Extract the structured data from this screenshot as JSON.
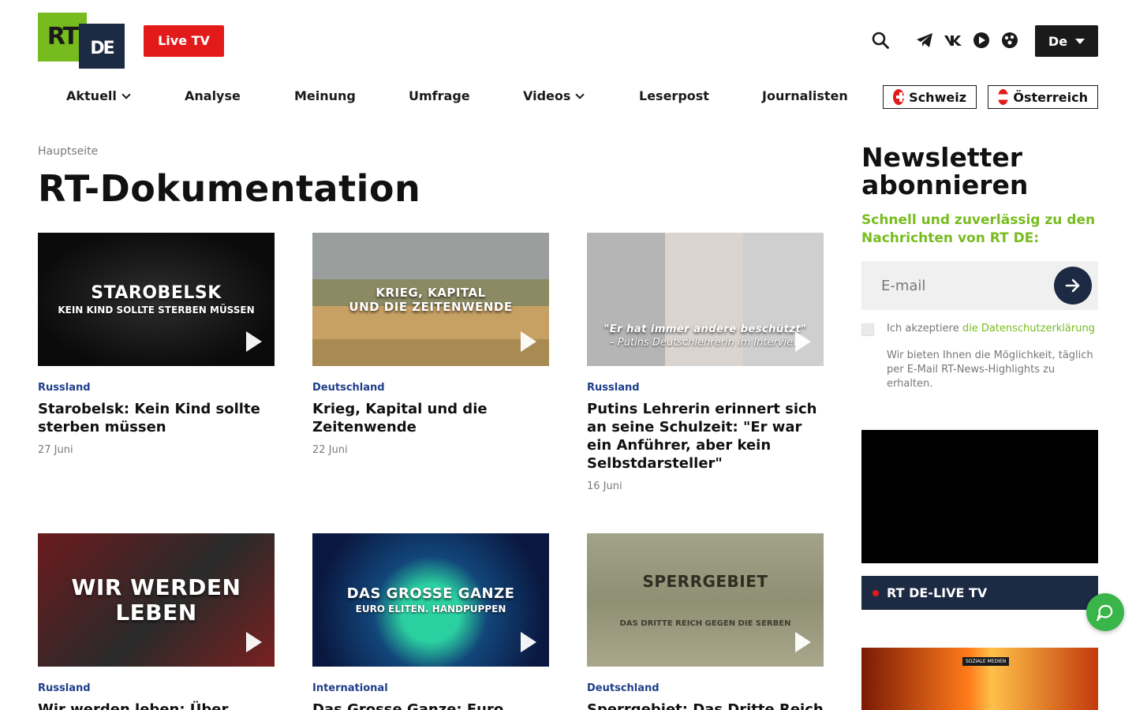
{
  "brand": {
    "logo_left": "RT",
    "logo_right": "DE",
    "green": "#77bc1f",
    "navy": "#1c2a44",
    "red": "#e31a1a"
  },
  "header": {
    "live_label": "Live TV",
    "lang_label": "De",
    "icons": [
      "search-icon",
      "telegram-icon",
      "vk-icon",
      "rutube-icon",
      "odysee-icon"
    ]
  },
  "nav": {
    "items": [
      {
        "label": "Aktuell",
        "has_dropdown": true
      },
      {
        "label": "Analyse",
        "has_dropdown": false
      },
      {
        "label": "Meinung",
        "has_dropdown": false
      },
      {
        "label": "Umfrage",
        "has_dropdown": false
      },
      {
        "label": "Videos",
        "has_dropdown": true
      },
      {
        "label": "Leserpost",
        "has_dropdown": false
      },
      {
        "label": "Journalisten",
        "has_dropdown": false
      }
    ],
    "countries": [
      {
        "label": "Schweiz"
      },
      {
        "label": "Österreich"
      }
    ]
  },
  "main": {
    "breadcrumb": "Hauptseite",
    "title": "RT-Dokumentation",
    "cards": [
      {
        "category": "Russland",
        "title": "Starobelsk: Kein Kind sollte sterben müssen",
        "date": "27 Juni",
        "thumb_line1": "STAROBELSK",
        "thumb_line2": "KEIN KIND SOLLTE STERBEN MÜSSEN"
      },
      {
        "category": "Deutschland",
        "title": "Krieg, Kapital und die Zeitenwende",
        "date": "22 Juni",
        "thumb_line1": "KRIEG, KAPITAL",
        "thumb_line2": "UND DIE ZEITENWENDE"
      },
      {
        "category": "Russland",
        "title": "Putins Lehrerin erinnert sich an seine Schulzeit: \"Er war ein Anführer, aber kein Selbstdarsteller\"",
        "date": "16 Juni",
        "thumb_line1": "\"Er hat immer andere beschützt\"",
        "thumb_line2": "– Putins Deutschlehrerin im Interview"
      },
      {
        "category": "Russland",
        "title": "Wir werden leben: Über",
        "date": "",
        "thumb_line1": "WIR WERDEN",
        "thumb_line2": "LEBEN"
      },
      {
        "category": "International",
        "title": "Das Grosse Ganze: Euro",
        "date": "",
        "thumb_line1": "DAS GROSSE GANZE",
        "thumb_line2": "EURO ELITEN. HANDPUPPEN"
      },
      {
        "category": "Deutschland",
        "title": "Sperrgebiet: Das Dritte Reich",
        "date": "",
        "thumb_line1": "SPERRGEBIET",
        "thumb_line2": "DAS DRITTE REICH GEGEN DIE SERBEN"
      }
    ]
  },
  "sidebar": {
    "newsletter_title": "Newsletter abonnieren",
    "newsletter_sub": "Schnell und zuverlässig zu den Nachrichten von RT DE:",
    "email_placeholder": "E-mail",
    "consent_prefix": "Ich akzeptiere",
    "consent_link": "die Datenschutzerklärung",
    "consent_info": "Wir bieten Ihnen die Möglichkeit, täglich per E-Mail RT-News-Highlights zu erhalten.",
    "live_label": "RT DE-LIVE TV",
    "thumb_badge": "SOZIALE MEDIEN"
  }
}
